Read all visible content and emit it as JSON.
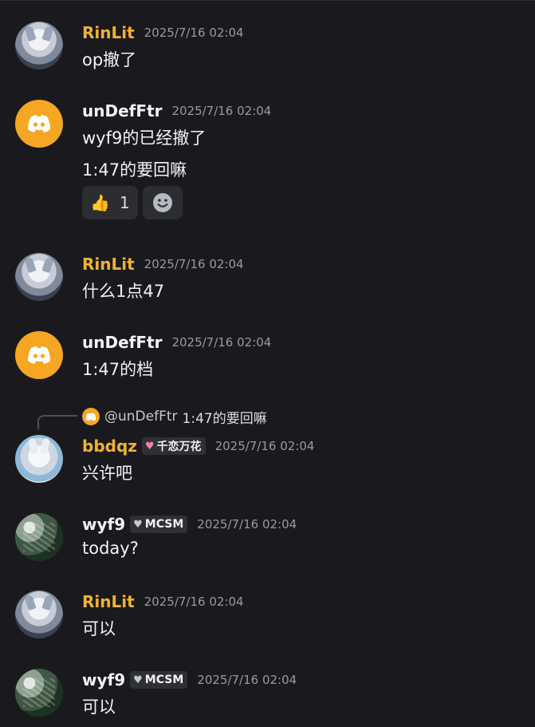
{
  "messages": [
    {
      "author": "RinLit",
      "timestamp": "2025/7/16 02:04",
      "lines": [
        "op撤了"
      ]
    },
    {
      "author": "unDefFtr",
      "timestamp": "2025/7/16 02:04",
      "lines": [
        "wyf9的已经撤了",
        "1:47的要回嘛"
      ],
      "reactions": [
        {
          "emoji": "👍",
          "count": "1"
        }
      ],
      "add_reaction_icon": "smiley-icon"
    },
    {
      "author": "RinLit",
      "timestamp": "2025/7/16 02:04",
      "lines": [
        "什么1点47"
      ]
    },
    {
      "author": "unDefFtr",
      "timestamp": "2025/7/16 02:04",
      "lines": [
        "1:47的档"
      ]
    },
    {
      "reply_to": {
        "user": "@unDefFtr",
        "text": "1:47的要回嘛"
      },
      "author": "bbdqz",
      "badge": {
        "icon": "pink-heart-icon",
        "label": "千恋万花"
      },
      "timestamp": "2025/7/16 02:04",
      "lines": [
        "兴许吧"
      ]
    },
    {
      "author": "wyf9",
      "badge": {
        "icon": "grey-heart-icon",
        "label": "MCSM"
      },
      "timestamp": "2025/7/16 02:04",
      "lines": [
        "today?"
      ]
    },
    {
      "author": "RinLit",
      "timestamp": "2025/7/16 02:04",
      "lines": [
        "可以"
      ]
    },
    {
      "author": "wyf9",
      "badge": {
        "icon": "grey-heart-icon",
        "label": "MCSM"
      },
      "timestamp": "2025/7/16 02:04",
      "lines": [
        "可以"
      ]
    }
  ],
  "colors": {
    "background": "#1a1a1e",
    "gold_name": "#f0b232",
    "discord_orange": "#f5a623",
    "timestamp": "#949ba4"
  }
}
